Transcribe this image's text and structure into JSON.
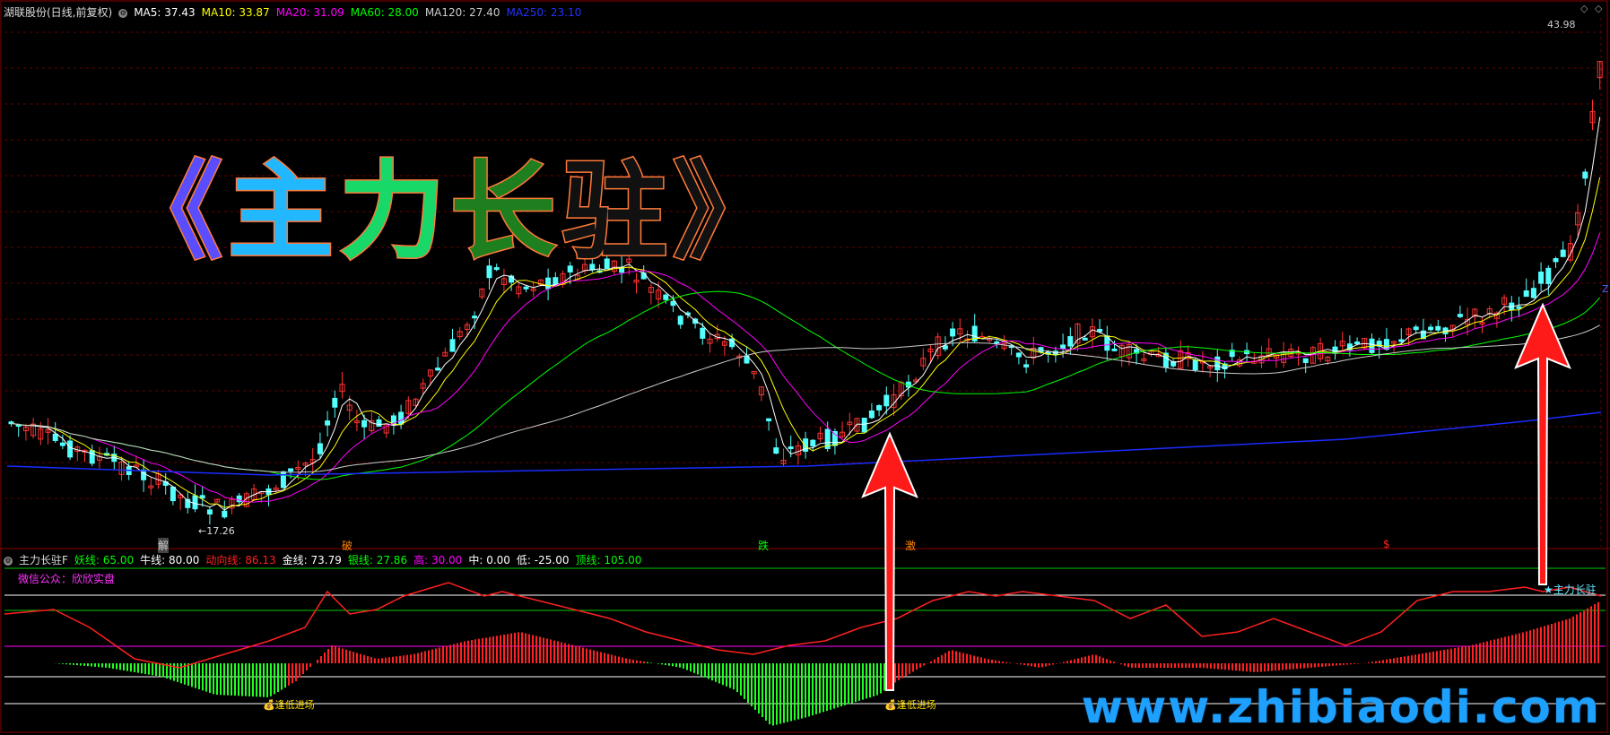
{
  "price_panel": {
    "stock_title": "湖联股份(日线,前复权)",
    "ma": [
      {
        "label": "MA5:",
        "value": "37.43",
        "color": "#ffffff"
      },
      {
        "label": "MA10:",
        "value": "33.87",
        "color": "#ffff00"
      },
      {
        "label": "MA20:",
        "value": "31.09",
        "color": "#ff00ff"
      },
      {
        "label": "MA60:",
        "value": "28.00",
        "color": "#00ff00"
      },
      {
        "label": "MA120:",
        "value": "27.40",
        "color": "#cccccc"
      },
      {
        "label": "MA250:",
        "value": "23.10",
        "color": "#0000ff"
      }
    ],
    "high_label": "43.98",
    "low_label": "←17.26",
    "signals": [
      {
        "text": "解",
        "color": "#ffffff"
      },
      {
        "text": "破",
        "color": "#ff8800"
      },
      {
        "text": "跌",
        "color": "#00ff00"
      },
      {
        "text": "激",
        "color": "#ff8800"
      },
      {
        "text": "$",
        "color": "#ff2222"
      }
    ],
    "right_marker": "Z"
  },
  "title_banner": {
    "chars": [
      "《",
      "主",
      "力",
      "长",
      "驻",
      "》"
    ]
  },
  "indicator_panel": {
    "name": "主力长驻F",
    "params": [
      {
        "label": "妖线:",
        "value": "65.00",
        "color": "#00ff00"
      },
      {
        "label": "牛线:",
        "value": "80.00",
        "color": "#ffffff"
      },
      {
        "label": "动向线:",
        "value": "86.13",
        "color": "#ff0000"
      },
      {
        "label": "金线:",
        "value": "73.79",
        "color": "#ffffff"
      },
      {
        "label": "银线:",
        "value": "27.86",
        "color": "#00ff00"
      },
      {
        "label": "高:",
        "value": "30.00",
        "color": "#ff00ff"
      },
      {
        "label": "中:",
        "value": "0.00",
        "color": "#ffffff"
      },
      {
        "label": "低:",
        "value": "-25.00",
        "color": "#ffffff"
      },
      {
        "label": "顶线:",
        "value": "105.00",
        "color": "#00ff00"
      }
    ],
    "wechat": "微信公众：欣欣实盘",
    "entry_label_1": "逢低进场",
    "entry_label_2": "逢低进场",
    "marker_label": "★主力长驻"
  },
  "watermark": "www.zhibiaodi.com",
  "colors": {
    "up": "#ff3333",
    "down": "#54ffff",
    "bg": "#000000"
  }
}
